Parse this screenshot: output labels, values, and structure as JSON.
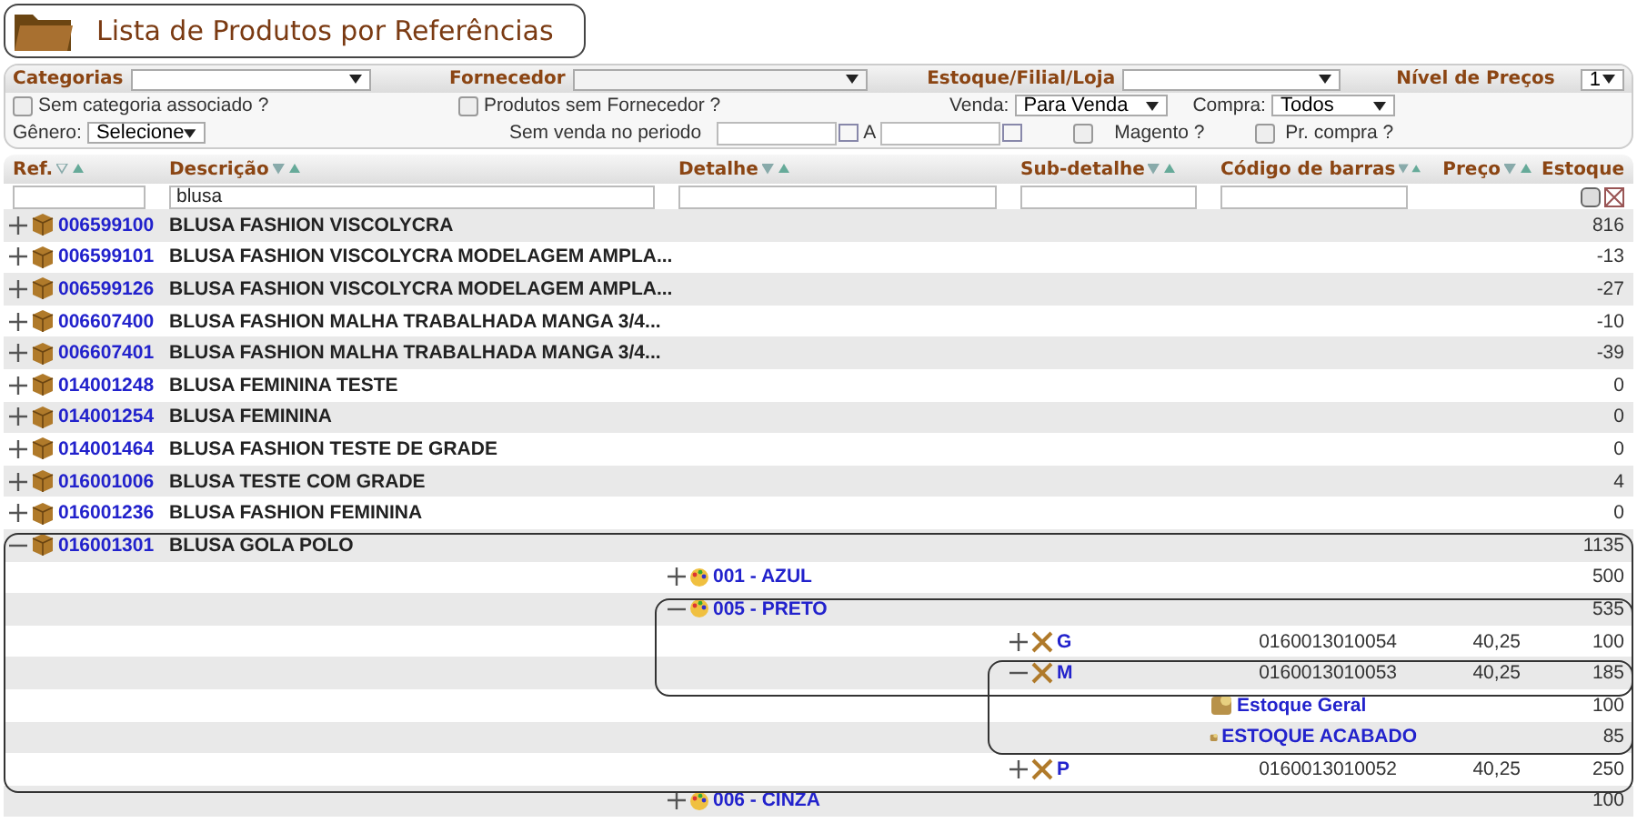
{
  "title": "Lista de Produtos por Referências",
  "filters": {
    "categorias": {
      "label": "Categorias"
    },
    "fornecedor": {
      "label": "Fornecedor",
      "disabled": true
    },
    "estoque": {
      "label": "Estoque/Filial/Loja"
    },
    "nivel": {
      "label": "Nível de Preços",
      "value": "1"
    },
    "sem_categoria": {
      "label": "Sem categoria associado ?",
      "checked": false
    },
    "sem_fornecedor": {
      "label": "Produtos sem Fornecedor ?",
      "checked": false
    },
    "venda": {
      "label": "Venda:",
      "value": "Para Venda"
    },
    "compra": {
      "label": "Compra:",
      "value": "Todos"
    },
    "genero": {
      "label": "Gênero:",
      "value": "Selecione"
    },
    "sem_venda": {
      "label": "Sem venda no periodo",
      "separator": "A"
    },
    "magento": {
      "label": "Magento ?",
      "checked": false
    },
    "pr_compra": {
      "label": "Pr. compra ?",
      "checked": false
    }
  },
  "columns": [
    {
      "label": "Ref.",
      "sortable": true,
      "has_filter": true
    },
    {
      "label": "Descrição",
      "sortable": true,
      "has_filter": true,
      "filter": "blusa"
    },
    {
      "label": "Detalhe",
      "sortable": true,
      "has_filter": true
    },
    {
      "label": "Sub-detalhe",
      "sortable": true,
      "has_filter": true
    },
    {
      "label": "Código de barras",
      "sortable": true,
      "has_filter": true
    },
    {
      "label": "Preço",
      "sortable": true
    },
    {
      "label": "Estoque",
      "sortable": false
    }
  ],
  "rows": [
    {
      "ref": "006599100",
      "description": "BLUSA FASHION VISCOLYCRA",
      "stock": "816",
      "expanded": false
    },
    {
      "ref": "006599101",
      "description": "BLUSA FASHION VISCOLYCRA MODELAGEM AMPLA...",
      "stock": "-13",
      "expanded": false
    },
    {
      "ref": "006599126",
      "description": "BLUSA FASHION VISCOLYCRA MODELAGEM AMPLA...",
      "stock": "-27",
      "expanded": false
    },
    {
      "ref": "006607400",
      "description": "BLUSA FASHION MALHA TRABALHADA MANGA 3/4...",
      "stock": "-10",
      "expanded": false
    },
    {
      "ref": "006607401",
      "description": "BLUSA FASHION MALHA TRABALHADA MANGA 3/4...",
      "stock": "-39",
      "expanded": false
    },
    {
      "ref": "014001248",
      "description": "BLUSA FEMININA TESTE",
      "stock": "0",
      "expanded": false
    },
    {
      "ref": "014001254",
      "description": "BLUSA FEMININA",
      "stock": "0",
      "expanded": false
    },
    {
      "ref": "014001464",
      "description": "BLUSA FASHION TESTE DE GRADE",
      "stock": "0",
      "expanded": false
    },
    {
      "ref": "016001006",
      "description": "BLUSA TESTE COM GRADE",
      "stock": "4",
      "expanded": false
    },
    {
      "ref": "016001236",
      "description": "BLUSA FASHION FEMININA",
      "stock": "0",
      "expanded": false
    },
    {
      "ref": "016001301",
      "description": "BLUSA GOLA POLO",
      "stock": "1135",
      "expanded": true,
      "children": [
        {
          "kind": "color",
          "label": "001 - AZUL",
          "stock": "500",
          "expanded": false
        },
        {
          "kind": "color",
          "label": "005 - PRETO",
          "stock": "535",
          "expanded": true,
          "children": [
            {
              "kind": "size",
              "label": "G",
              "barcode": "0160013010054",
              "price": "40,25",
              "stock": "100",
              "expanded": false
            },
            {
              "kind": "size",
              "label": "M",
              "barcode": "0160013010053",
              "price": "40,25",
              "stock": "185",
              "expanded": true,
              "children": [
                {
                  "kind": "location",
                  "label": "Estoque Geral",
                  "stock": "100"
                },
                {
                  "kind": "location",
                  "label": "ESTOQUE ACABADO",
                  "stock": "85"
                }
              ]
            },
            {
              "kind": "size",
              "label": "P",
              "barcode": "0160013010052",
              "price": "40,25",
              "stock": "250",
              "expanded": false
            }
          ]
        },
        {
          "kind": "color",
          "label": "006 - CINZA",
          "stock": "100",
          "expanded": false
        }
      ]
    }
  ]
}
